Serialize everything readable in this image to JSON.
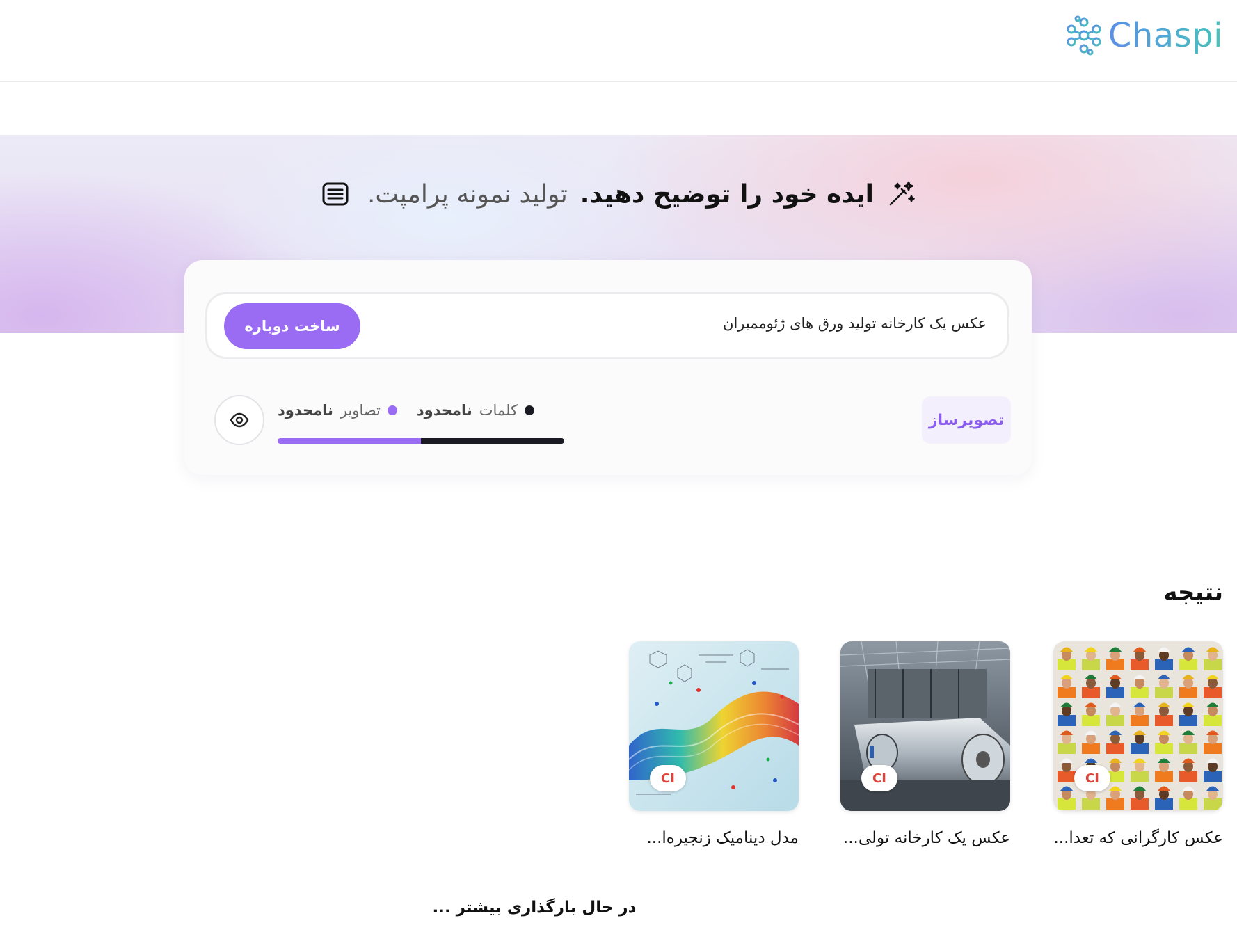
{
  "app": {
    "logo_text": "Chaspi"
  },
  "hero": {
    "title_strong": "ایده خود را توضیح دهید.",
    "title_light": "تولید نمونه پرامپت."
  },
  "prompt": {
    "text": "عکس یک کارخانه تولید ورق های ژئوممبران",
    "rebuild_label": "ساخت دوباره"
  },
  "quota": {
    "words_label": "کلمات",
    "words_value": "نامحدود",
    "words_color": "#1a1a22",
    "images_label": "تصاویر",
    "images_value": "نامحدود",
    "images_color": "#9a6bf3",
    "images_fraction": 0.5
  },
  "tool_tag": "تصویرساز",
  "results": {
    "title": "نتیجه",
    "items": [
      {
        "caption": "عکس کارگرانی که تعدا...",
        "badge": "CI"
      },
      {
        "caption": "عکس یک کارخانه تولی...",
        "badge": "CI"
      },
      {
        "caption": "مدل دینامیک زنجیره‌ا...",
        "badge": "CI"
      }
    ]
  },
  "loading_text": "در حال بارگذاری بیشتر ..."
}
